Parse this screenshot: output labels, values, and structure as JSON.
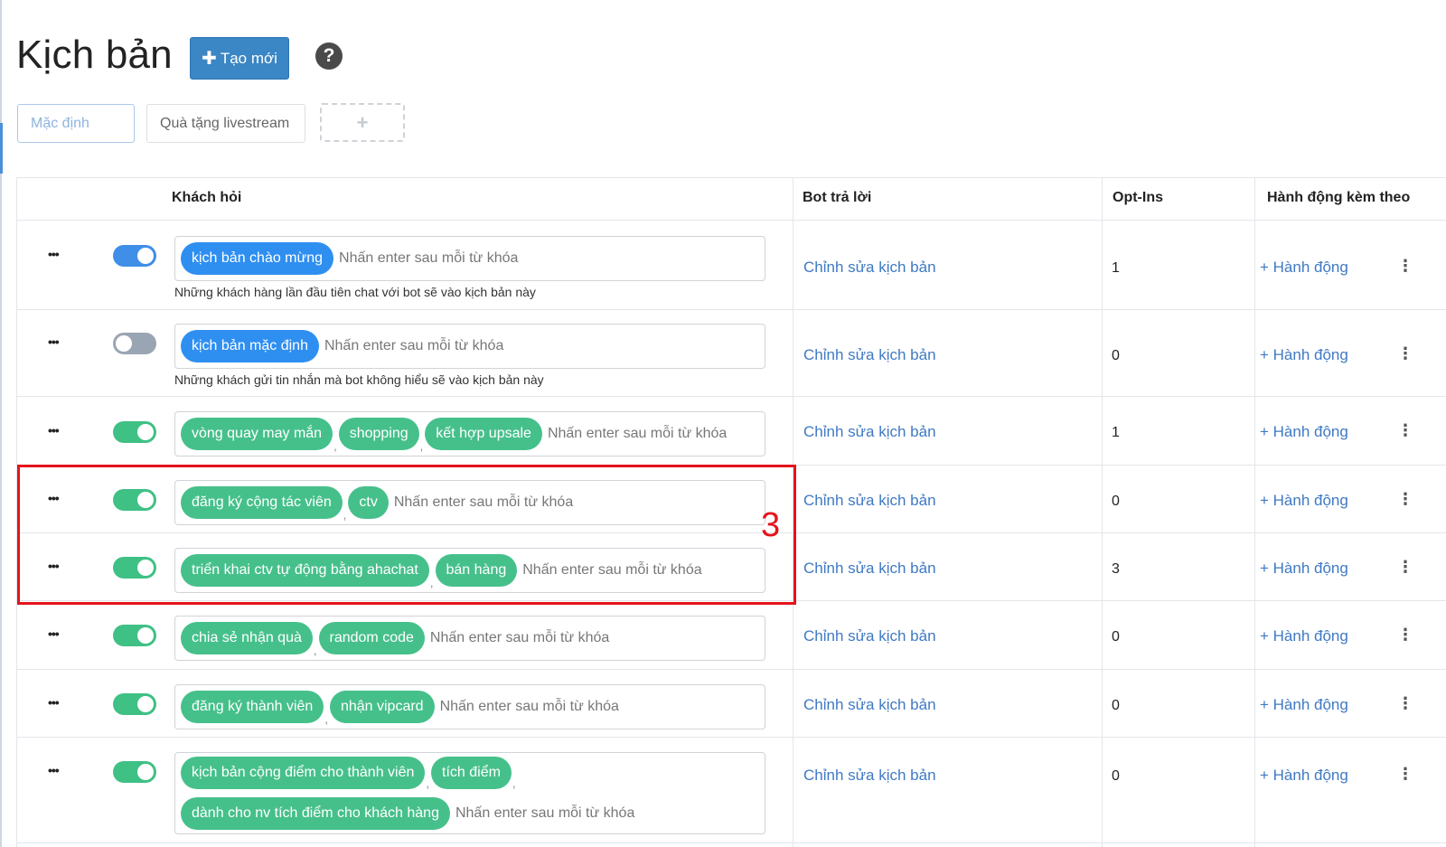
{
  "page": {
    "title": "Kịch bản"
  },
  "header": {
    "create_label": "Tạo mới",
    "create_icon": "plus-icon",
    "help_icon": "question-circle-icon",
    "help_glyph": "?"
  },
  "tabs": [
    {
      "label": "Mặc định",
      "active": true
    },
    {
      "label": "Quà tặng livestream",
      "active": false
    }
  ],
  "add_tab_glyph": "+",
  "table": {
    "columns": [
      "Khách hỏi",
      "Bot trả lời",
      "Opt-Ins",
      "Hành động kèm theo"
    ],
    "rows": [
      {
        "enabled": true,
        "toggle_color": "blue",
        "keywords": [
          "kịch bản chào mừng"
        ],
        "chip_color": "blue",
        "placeholder": "Nhấn enter sau mỗi từ khóa",
        "description": "Những khách hàng lần đầu tiên chat với bot sẽ vào kịch bản này",
        "bot_reply": "Chỉnh sửa kịch bản",
        "optins": "1",
        "action": "+ Hành động"
      },
      {
        "enabled": false,
        "toggle_color": "gray",
        "keywords": [
          "kịch bản mặc định"
        ],
        "chip_color": "blue",
        "placeholder": "Nhấn enter sau mỗi từ khóa",
        "description": "Những khách gửi tin nhắn mà bot không hiểu sẽ vào kịch bản này",
        "bot_reply": "Chỉnh sửa kịch bản",
        "optins": "0",
        "action": "+ Hành động"
      },
      {
        "enabled": true,
        "toggle_color": "green",
        "keywords": [
          "vòng quay may mắn",
          "shopping",
          "kết hợp upsale"
        ],
        "chip_color": "green",
        "placeholder": "Nhấn enter sau mỗi từ khóa",
        "bot_reply": "Chỉnh sửa kịch bản",
        "optins": "1",
        "action": "+ Hành động"
      },
      {
        "enabled": true,
        "toggle_color": "green",
        "keywords": [
          "đăng ký cộng tác viên",
          "ctv"
        ],
        "chip_color": "green",
        "placeholder": "Nhấn enter sau mỗi từ khóa",
        "bot_reply": "Chỉnh sửa kịch bản",
        "optins": "0",
        "action": "+ Hành động"
      },
      {
        "enabled": true,
        "toggle_color": "green",
        "keywords": [
          "triển khai ctv tự động bằng ahachat",
          "bán hàng"
        ],
        "chip_color": "green",
        "placeholder": "Nhấn enter sau mỗi từ khóa",
        "bot_reply": "Chỉnh sửa kịch bản",
        "optins": "3",
        "action": "+ Hành động"
      },
      {
        "enabled": true,
        "toggle_color": "green",
        "keywords": [
          "chia sẻ nhận quà",
          "random code"
        ],
        "chip_color": "green",
        "placeholder": "Nhấn enter sau mỗi từ khóa",
        "bot_reply": "Chỉnh sửa kịch bản",
        "optins": "0",
        "action": "+ Hành động"
      },
      {
        "enabled": true,
        "toggle_color": "green",
        "keywords": [
          "đăng ký thành viên",
          "nhận vipcard"
        ],
        "chip_color": "green",
        "placeholder": "Nhấn enter sau mỗi từ khóa",
        "bot_reply": "Chỉnh sửa kịch bản",
        "optins": "0",
        "action": "+ Hành động"
      },
      {
        "enabled": true,
        "toggle_color": "green",
        "keywords": [
          "kịch bản cộng điểm cho thành viên",
          "tích điểm",
          "dành cho nv tích điểm cho khách hàng"
        ],
        "chip_color": "green",
        "placeholder": "Nhấn enter sau mỗi từ khóa",
        "bot_reply": "Chỉnh sửa kịch bản",
        "optins": "0",
        "action": "+ Hành động"
      }
    ]
  },
  "row_menu_glyph": "•••",
  "row_kebab_glyph": "⋮",
  "annotation": {
    "label": "3",
    "color": "#e4141c"
  },
  "colors": {
    "primary": "#3b86c4",
    "chip_green": "#46c08b",
    "chip_blue": "#2f8ff0",
    "toggle_green": "#3fc085",
    "link": "#3f79c3"
  }
}
